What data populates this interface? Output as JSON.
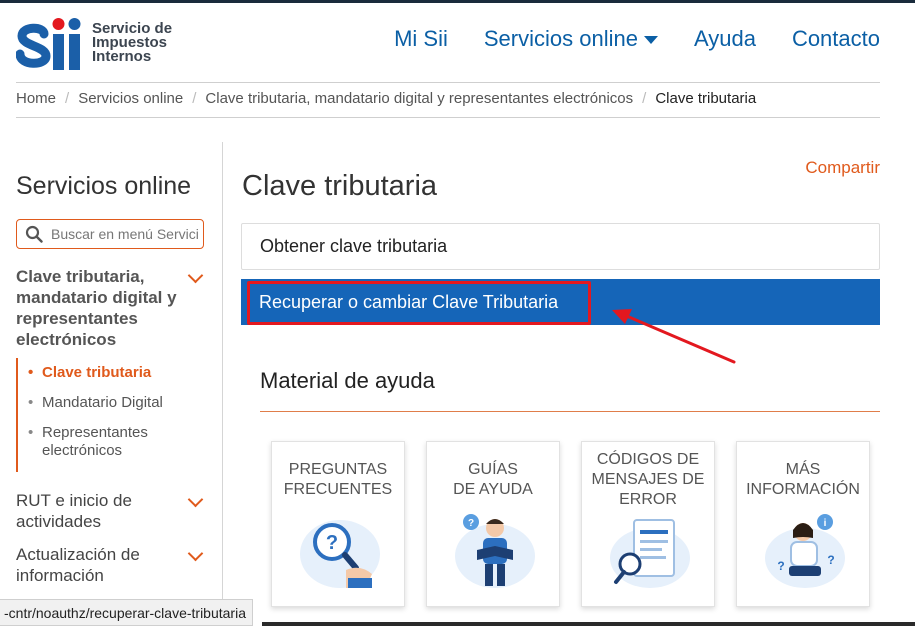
{
  "header": {
    "logo_letters": "SII",
    "logo_text": [
      "Servicio de",
      "Impuestos",
      "Internos"
    ],
    "nav": [
      {
        "label": "Mi Sii"
      },
      {
        "label": "Servicios online",
        "has_dropdown": true
      },
      {
        "label": "Ayuda"
      },
      {
        "label": "Contacto"
      }
    ]
  },
  "breadcrumb": {
    "items": [
      "Home",
      "Servicios online",
      "Clave tributaria, mandatario digital y representantes electrónicos"
    ],
    "current": "Clave tributaria"
  },
  "sidebar": {
    "title": "Servicios online",
    "search_placeholder": "Buscar en menú Servicios online",
    "categories": [
      {
        "label": "Clave tributaria, mandatario digital y representantes electrónicos",
        "expanded": true
      },
      {
        "label": "RUT e inicio de actividades"
      },
      {
        "label": "Actualización de información"
      }
    ],
    "subitems": [
      {
        "label": "Clave tributaria",
        "active": true
      },
      {
        "label": "Mandatario Digital"
      },
      {
        "label": "Representantes electrónicos"
      }
    ]
  },
  "main": {
    "title": "Clave tributaria",
    "share_label": "Compartir",
    "accordion": [
      {
        "label": "Obtener clave tributaria"
      },
      {
        "label": "Recuperar o cambiar Clave Tributaria",
        "active": true
      }
    ],
    "help_title": "Material de ayuda",
    "cards": [
      {
        "lines": [
          "PREGUNTAS",
          "FRECUENTES"
        ],
        "icon": "faq-magnifier-icon"
      },
      {
        "lines": [
          "GUÍAS",
          "DE AYUDA"
        ],
        "icon": "guide-reader-icon"
      },
      {
        "lines": [
          "CÓDIGOS DE",
          "MENSAJES DE",
          "ERROR"
        ],
        "icon": "error-document-icon"
      },
      {
        "lines": [
          "MÁS",
          "INFORMACIÓN"
        ],
        "icon": "info-person-icon"
      }
    ]
  },
  "status_url": "-cntr/noauthz/recuperar-clave-tributaria",
  "colors": {
    "brand_blue": "#0b5fa5",
    "accent_orange": "#e05a1c",
    "active_blue": "#1565b8",
    "annotation_red": "#e3181f"
  }
}
